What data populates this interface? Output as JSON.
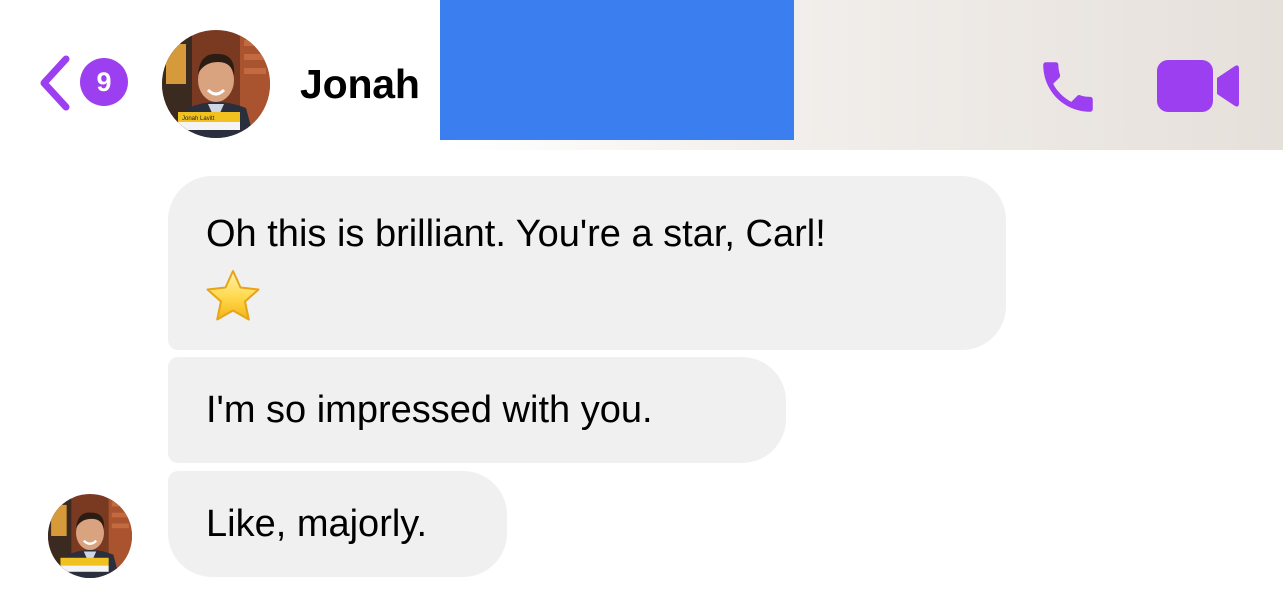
{
  "header": {
    "back": {
      "unread_count": "9",
      "icon": "chevron-left-icon"
    },
    "contact_name": "Jonah",
    "avatar_caption": "Jonah Lavitt",
    "actions": {
      "phone_icon": "phone-icon",
      "video_icon": "video-camera-icon"
    }
  },
  "colors": {
    "accent": "#9b3ff0",
    "bubble_incoming": "#f0f0f0",
    "redaction": "#3b7ef0"
  },
  "messages": [
    {
      "text": "Oh this is brilliant. You're a star, Carl!",
      "emoji": "star-icon"
    },
    {
      "text": "I'm so impressed with you."
    },
    {
      "text": "Like, majorly."
    }
  ]
}
